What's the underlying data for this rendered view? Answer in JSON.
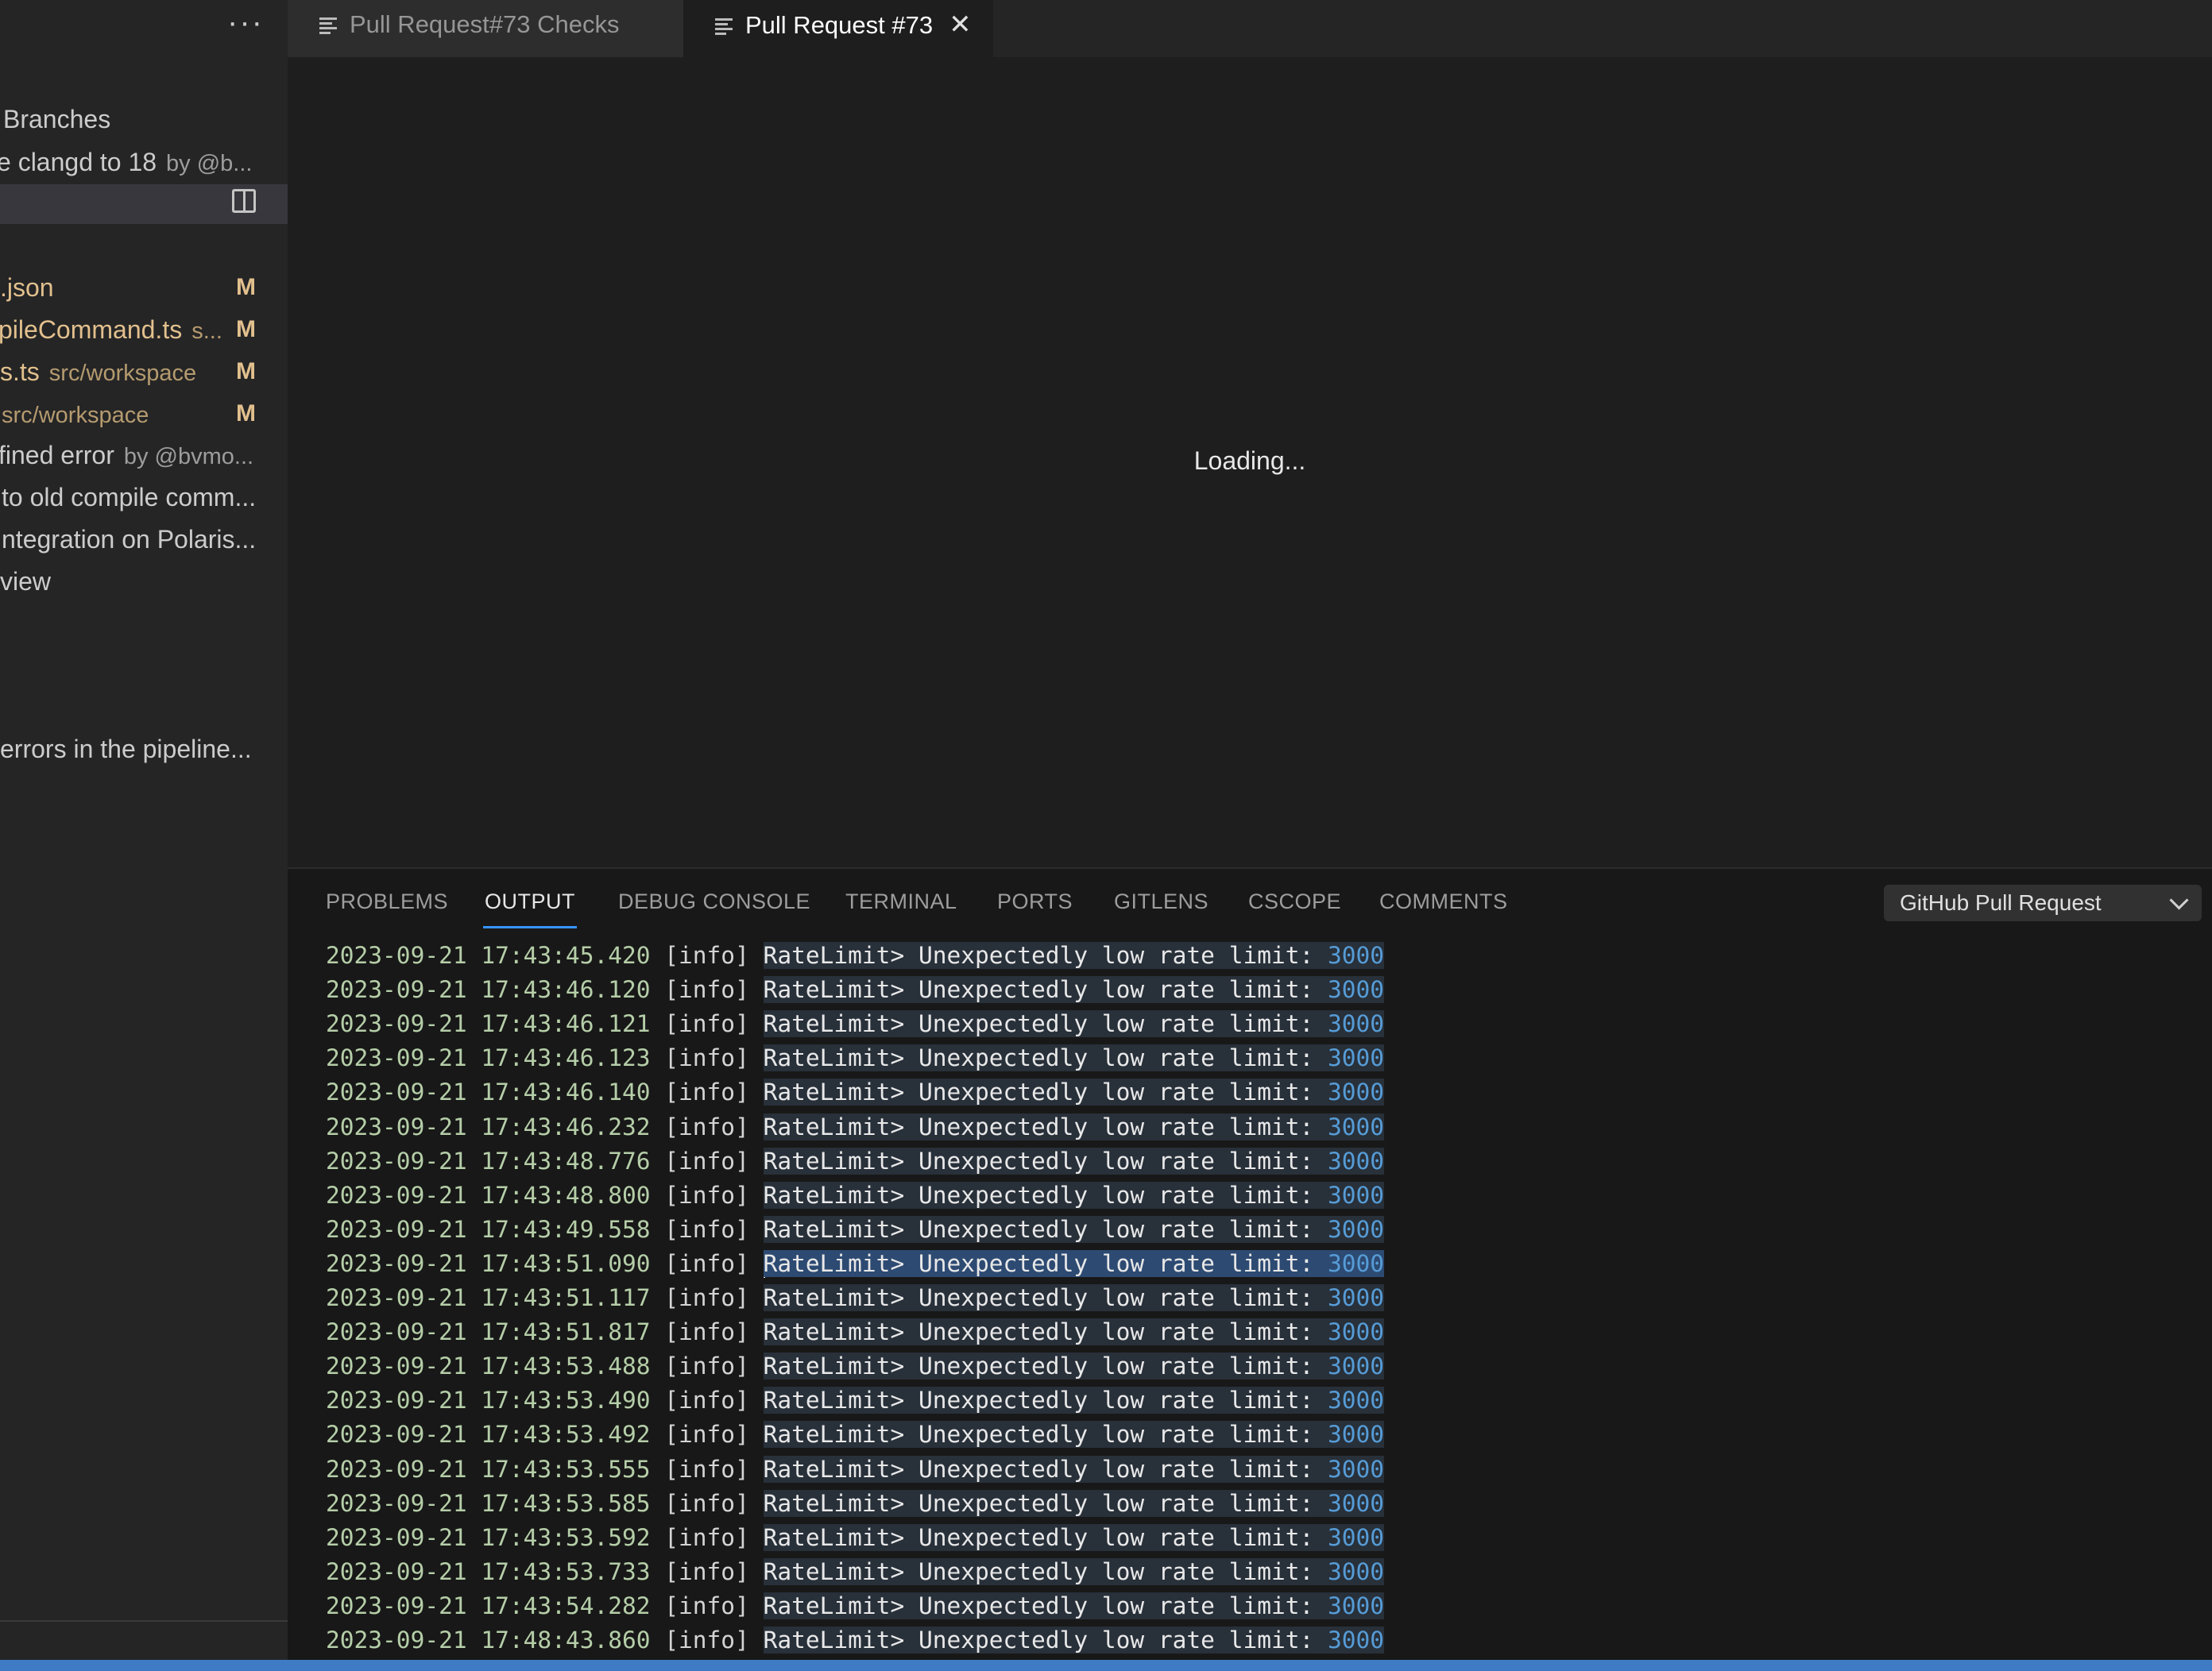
{
  "sidebar": {
    "more_label": "···",
    "items": [
      {
        "label": "Branches",
        "desc": "",
        "mod": ""
      },
      {
        "label": "e clangd to 18",
        "desc": "by @b...",
        "mod": ""
      }
    ],
    "files": [
      {
        "label": ".json",
        "desc": "",
        "mod": "M"
      },
      {
        "label": "pileCommand.ts",
        "desc": "s...",
        "mod": "M"
      },
      {
        "label": "s.ts",
        "desc": "src/workspace",
        "mod": "M"
      },
      {
        "label": "",
        "desc": "src/workspace",
        "mod": "M"
      }
    ],
    "more_items": [
      {
        "label": "fined error",
        "desc": "by @bvmo..."
      },
      {
        "label": "to old compile comm...",
        "desc": ""
      },
      {
        "label": "ntegration on Polaris...",
        "desc": ""
      },
      {
        "label": "view",
        "desc": ""
      },
      {
        "label": "errors in the pipeline...",
        "desc": ""
      }
    ]
  },
  "tabs": [
    {
      "label": "Pull Request#73 Checks",
      "active": false
    },
    {
      "label": "Pull Request #73",
      "active": true,
      "close": "✕"
    }
  ],
  "editor": {
    "loading_text": "Loading..."
  },
  "panel": {
    "tabs": [
      "PROBLEMS",
      "OUTPUT",
      "DEBUG CONSOLE",
      "TERMINAL",
      "PORTS",
      "GITLENS",
      "CSCOPE",
      "COMMENTS"
    ],
    "active_tab": "OUTPUT",
    "output_channel": "GitHub Pull Request",
    "log_level": "[info]",
    "log_message": "RateLimit> Unexpectedly low rate limit: ",
    "log_value": "3000",
    "selected_index": 9,
    "log_timestamps": [
      "2023-09-21 17:43:45.420",
      "2023-09-21 17:43:46.120",
      "2023-09-21 17:43:46.121",
      "2023-09-21 17:43:46.123",
      "2023-09-21 17:43:46.140",
      "2023-09-21 17:43:46.232",
      "2023-09-21 17:43:48.776",
      "2023-09-21 17:43:48.800",
      "2023-09-21 17:43:49.558",
      "2023-09-21 17:43:51.090",
      "2023-09-21 17:43:51.117",
      "2023-09-21 17:43:51.817",
      "2023-09-21 17:43:53.488",
      "2023-09-21 17:43:53.490",
      "2023-09-21 17:43:53.492",
      "2023-09-21 17:43:53.555",
      "2023-09-21 17:43:53.585",
      "2023-09-21 17:43:53.592",
      "2023-09-21 17:43:53.733",
      "2023-09-21 17:43:54.282",
      "2023-09-21 17:48:43.860"
    ]
  },
  "colors": {
    "accent": "#3794ff",
    "timestamp": "#b5cea8",
    "number": "#569cd6",
    "modified": "#e2c08d",
    "statusbar": "#3e7bc4"
  }
}
